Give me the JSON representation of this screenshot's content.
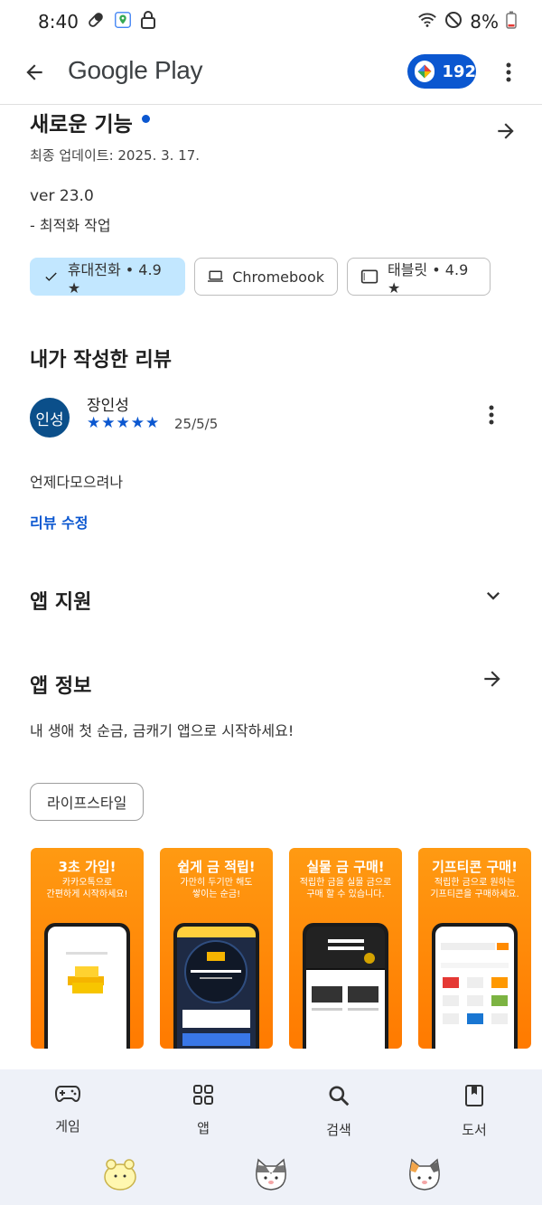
{
  "status": {
    "time": "8:40",
    "battery": "8%"
  },
  "app_bar": {
    "title": "Google Play",
    "points": "192"
  },
  "whats_new": {
    "title": "새로운 기능",
    "updated": "최종 업데이트: 2025. 3. 17.",
    "version": "ver 23.0",
    "note": "- 최적화 작업"
  },
  "device_chips": [
    {
      "label": "휴대전화 • 4.9 ★",
      "selected": true
    },
    {
      "label": "Chromebook",
      "selected": false
    },
    {
      "label": "태블릿 • 4.9 ★",
      "selected": false
    }
  ],
  "my_review": {
    "heading": "내가 작성한 리뷰",
    "avatar_text": "인성",
    "name": "장인성",
    "stars": "★★★★★",
    "rating": 5,
    "date": "25/5/5",
    "text": "언제다모으려나",
    "edit_label": "리뷰 수정"
  },
  "app_support": {
    "heading": "앱 지원"
  },
  "app_info": {
    "heading": "앱 정보",
    "description": "내 생애 첫 순금, 금캐기 앱으로 시작하세요!",
    "category": "라이프스타일"
  },
  "screenshots": [
    {
      "title": "3초 가입!",
      "subtitle": "카카오톡으로\n간편하게 시작하세요!"
    },
    {
      "title": "쉽게 금 적립!",
      "subtitle": "가만히 두기만 해도\n쌓이는 순금!"
    },
    {
      "title": "실물 금 구매!",
      "subtitle": "적립한 금을 실물 금으로\n구매 할 수 있습니다."
    },
    {
      "title": "기프티콘 구매!",
      "subtitle": "적립한 금으로 원하는\n기프티콘을 구매하세요."
    }
  ],
  "bottom_nav": [
    {
      "label": "게임",
      "icon": "gamepad-icon"
    },
    {
      "label": "앱",
      "icon": "apps-grid-icon"
    },
    {
      "label": "검색",
      "icon": "search-icon"
    },
    {
      "label": "도서",
      "icon": "book-icon"
    }
  ],
  "colors": {
    "accent": "#0b57d0",
    "chip_selected": "#c2e7ff",
    "nav_bg": "#eef1f8",
    "screenshot_orange": "#ff8a00"
  }
}
